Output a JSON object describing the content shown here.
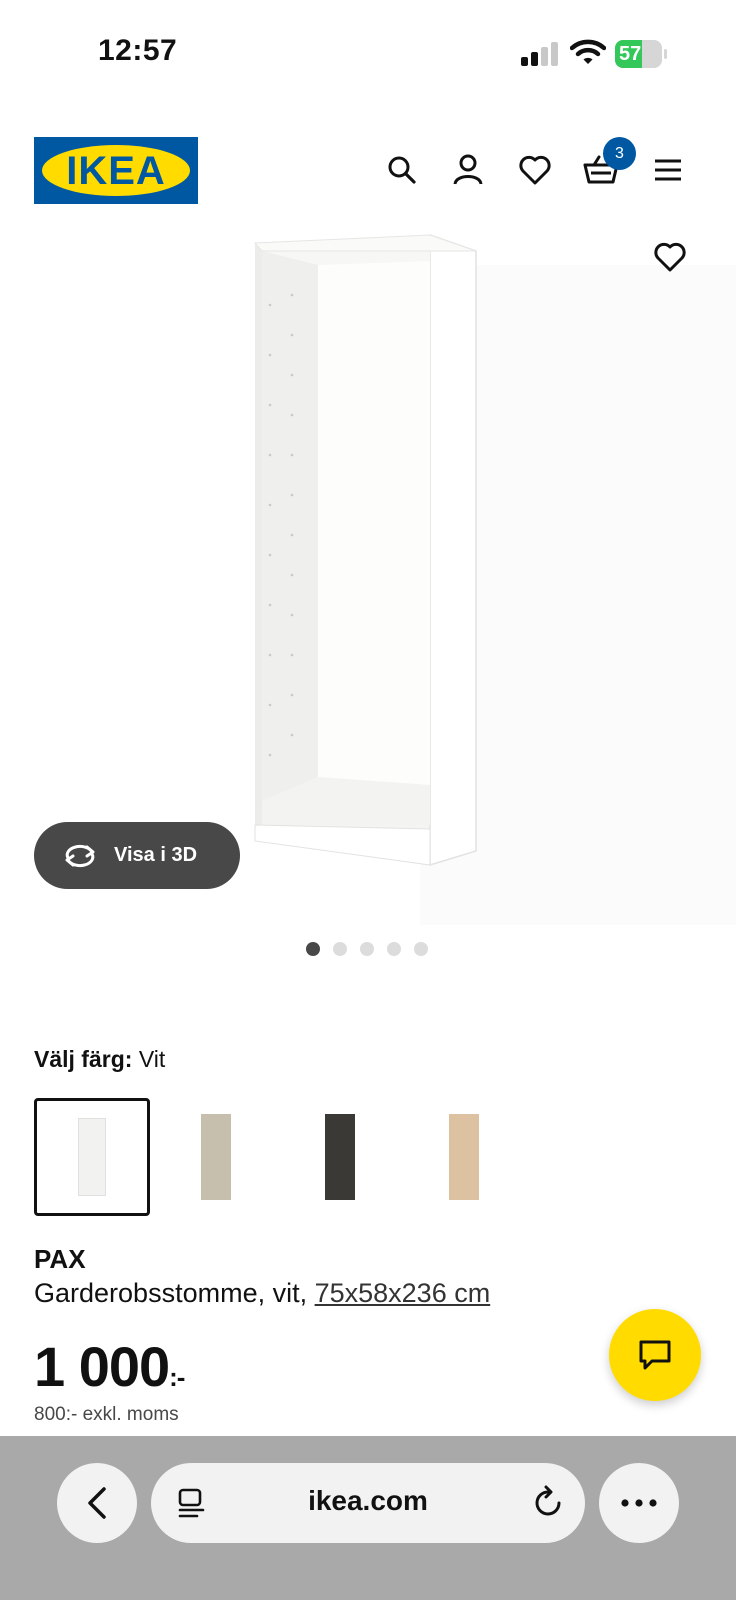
{
  "status_bar": {
    "time": "12:57",
    "battery_percent": 57,
    "battery_label": "57",
    "signal_bars_active": 2,
    "signal_bars_total": 4
  },
  "header": {
    "logo_text": "IKEA",
    "logo_reg": "®",
    "cart_count": "3",
    "icons": [
      "search-icon",
      "user-icon",
      "heart-icon",
      "cart-icon",
      "menu-icon"
    ]
  },
  "gallery": {
    "view_3d_label": "Visa i 3D",
    "dots_total": 5,
    "active_dot": 1
  },
  "color": {
    "label": "Välj färg:",
    "selected": "Vit",
    "swatches": [
      {
        "name": "white",
        "color": "#f2f2f0",
        "selected": true
      },
      {
        "name": "beige",
        "color": "#c7bfae",
        "selected": false
      },
      {
        "name": "black-brown",
        "color": "#3b3935",
        "selected": false
      },
      {
        "name": "oak",
        "color": "#dcc2a1",
        "selected": false
      }
    ]
  },
  "product": {
    "name": "PAX",
    "description": "Garderobsstomme, vit, ",
    "dimensions": "75x58x236 cm",
    "price": "1 000",
    "price_suffix": ":-",
    "price_excl": "800:- exkl. moms"
  },
  "browser": {
    "url": "ikea.com"
  },
  "colors": {
    "ikea_blue": "#0058a3",
    "ikea_yellow": "#ffdb00",
    "toolbar_gray": "#a9a9a9"
  }
}
